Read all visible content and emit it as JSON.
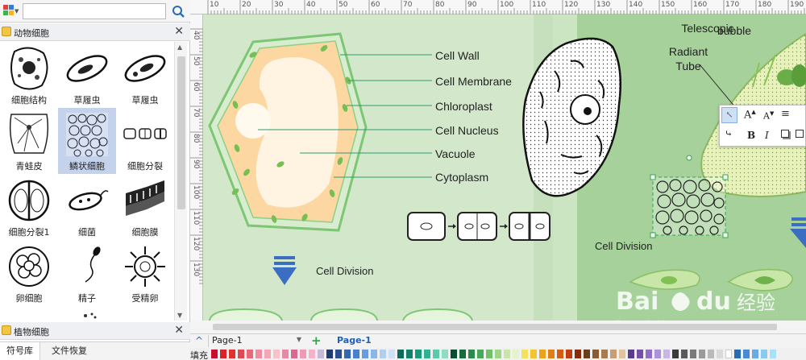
{
  "search": {
    "placeholder": ""
  },
  "library_top": {
    "title": "动物细胞"
  },
  "library_bottom": {
    "title": "植物细胞"
  },
  "shapes": [
    {
      "label": "细胞结构"
    },
    {
      "label": "草履虫"
    },
    {
      "label": "草履虫"
    },
    {
      "label": "青蛙皮"
    },
    {
      "label": "鳞状细胞"
    },
    {
      "label": "细胞分裂"
    },
    {
      "label": "细胞分裂1"
    },
    {
      "label": "细菌"
    },
    {
      "label": "细胞膜"
    },
    {
      "label": "卵细胞"
    },
    {
      "label": "精子"
    },
    {
      "label": "受精卵"
    }
  ],
  "left_tabs": {
    "symbols": "符号库",
    "recovery": "文件恢复"
  },
  "ruler_top": [
    "10",
    "20",
    "30",
    "40",
    "50",
    "60",
    "70",
    "80",
    "90",
    "100",
    "110",
    "120",
    "130",
    "140",
    "150",
    "160",
    "170",
    "180",
    "190"
  ],
  "ruler_left": [
    "40",
    "50",
    "60",
    "70",
    "80",
    "90",
    "100",
    "110",
    "120",
    "130"
  ],
  "diagram": {
    "labels": {
      "cell_wall": "Cell Wall",
      "cell_membrane": "Cell Membrane",
      "chloroplast": "Chloroplast",
      "cell_nucleus": "Cell Nucleus",
      "vacuole": "Vacuole",
      "cytoplasm": "Cytoplasm",
      "cell_division_left": "Cell Division",
      "cell_division_right": "Cell Division",
      "telescopic_1": "Telescopic",
      "telescopic_2": "bubble",
      "radiant_1": "Radiant",
      "radiant_2": "Tube"
    }
  },
  "page_tabs": {
    "dropdown": "Page-1",
    "active": "Page-1"
  },
  "fill_label": "填充",
  "palette_colors": [
    "#c8102e",
    "#d6242d",
    "#e0322f",
    "#e04a52",
    "#e86a78",
    "#ef8ea0",
    "#f3a6b4",
    "#f7c2cc",
    "#e58aa6",
    "#d86a92",
    "#f09ab8",
    "#f5b2c8",
    "#c6b8d8",
    "#1f3a6e",
    "#2b4e8c",
    "#3667ae",
    "#4a7fcc",
    "#6b9bdc",
    "#8db6e8",
    "#b2cff0",
    "#cfe1f6",
    "#0e6a5a",
    "#12806a",
    "#1a9a7c",
    "#2cb392",
    "#5cc9aa",
    "#8fdcc2",
    "#0b4d2e",
    "#1a6b3c",
    "#2d8a4a",
    "#4aa85a",
    "#72c06c",
    "#a0d488",
    "#c9e6a8",
    "#e6f2cc",
    "#f5e060",
    "#f2c530",
    "#eaa41c",
    "#e07f16",
    "#d35c12",
    "#bf3d10",
    "#8a2a0c",
    "#6a3d1f",
    "#8a5a36",
    "#a87a52",
    "#c89e76",
    "#e2c3a0",
    "#5a3a8a",
    "#7450a8",
    "#9070c4",
    "#ac92d8",
    "#c8b6e8",
    "#3a3a3a",
    "#5a5a5a",
    "#7a7a7a",
    "#9a9a9a",
    "#bababa",
    "#dadada",
    "#ffffff",
    "#2a6ab0",
    "#4a8ad0",
    "#6aaae0",
    "#8acaf0",
    "#aae0f8"
  ]
}
